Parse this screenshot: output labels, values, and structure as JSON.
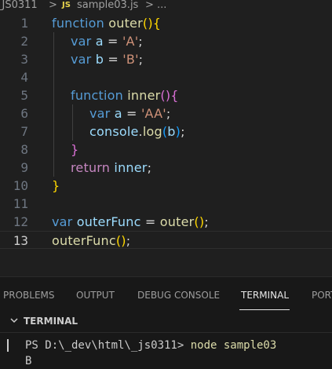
{
  "breadcrumb": {
    "folder": "_JS0311",
    "sep1": ">",
    "file_icon": "JS",
    "file": "sample03.js",
    "sep2": ">",
    "more": "..."
  },
  "editor": {
    "current_line": 13,
    "lines": [
      {
        "n": "1",
        "tokens": [
          [
            "kw",
            "function "
          ],
          [
            "fn",
            "outer"
          ],
          [
            "b1",
            "()"
          ],
          [
            "b1",
            "{"
          ]
        ]
      },
      {
        "n": "2",
        "tokens": [
          [
            "kw",
            "var "
          ],
          [
            "var",
            "a"
          ],
          [
            "op",
            " = "
          ],
          [
            "str",
            "'A'"
          ],
          [
            "op",
            ";"
          ]
        ]
      },
      {
        "n": "3",
        "tokens": [
          [
            "kw",
            "var "
          ],
          [
            "var",
            "b"
          ],
          [
            "op",
            " = "
          ],
          [
            "str",
            "'B'"
          ],
          [
            "op",
            ";"
          ]
        ]
      },
      {
        "n": "4",
        "tokens": []
      },
      {
        "n": "5",
        "tokens": [
          [
            "kw",
            "function "
          ],
          [
            "fn",
            "inner"
          ],
          [
            "b2",
            "()"
          ],
          [
            "b2",
            "{"
          ]
        ]
      },
      {
        "n": "6",
        "tokens": [
          [
            "kw",
            "var "
          ],
          [
            "var",
            "a"
          ],
          [
            "op",
            " = "
          ],
          [
            "str",
            "'AA'"
          ],
          [
            "op",
            ";"
          ]
        ]
      },
      {
        "n": "7",
        "tokens": [
          [
            "var",
            "console"
          ],
          [
            "op",
            "."
          ],
          [
            "fn",
            "log"
          ],
          [
            "b3",
            "("
          ],
          [
            "var",
            "b"
          ],
          [
            "b3",
            ")"
          ],
          [
            "op",
            ";"
          ]
        ]
      },
      {
        "n": "8",
        "tokens": [
          [
            "b2",
            "}"
          ]
        ]
      },
      {
        "n": "9",
        "tokens": [
          [
            "ctrl",
            "return "
          ],
          [
            "var",
            "inner"
          ],
          [
            "op",
            ";"
          ]
        ]
      },
      {
        "n": "10",
        "tokens": [
          [
            "b1",
            "}"
          ]
        ]
      },
      {
        "n": "11",
        "tokens": []
      },
      {
        "n": "12",
        "tokens": [
          [
            "kw",
            "var "
          ],
          [
            "var",
            "outerFunc"
          ],
          [
            "op",
            " = "
          ],
          [
            "fn",
            "outer"
          ],
          [
            "b1",
            "()"
          ],
          [
            "op",
            ";"
          ]
        ]
      },
      {
        "n": "13",
        "tokens": [
          [
            "fn",
            "outerFunc"
          ],
          [
            "b1",
            "()"
          ],
          [
            "op",
            ";"
          ]
        ]
      }
    ]
  },
  "panel": {
    "tabs": [
      "PROBLEMS",
      "OUTPUT",
      "DEBUG CONSOLE",
      "TERMINAL",
      "PORTS"
    ],
    "active_tab": "TERMINAL",
    "section_title": "TERMINAL"
  },
  "terminal": {
    "prompt": "PS D:\\_dev\\html\\_js0311> ",
    "command": "node sample03",
    "output": "B"
  },
  "colors": {
    "background": "#1f1f1f",
    "keyword": "#569cd6",
    "function": "#dcdcaa",
    "variable": "#9cdcfe",
    "string": "#ce9178"
  }
}
